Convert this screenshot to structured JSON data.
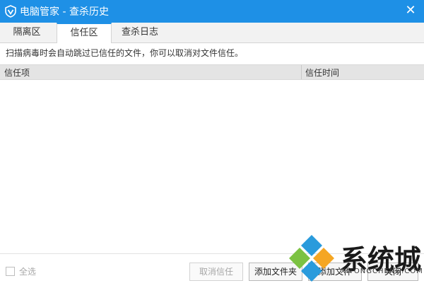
{
  "window": {
    "title": "电脑管家 - 查杀历史",
    "close_glyph": "✕"
  },
  "tabs": [
    {
      "label": "隔离区"
    },
    {
      "label": "信任区"
    },
    {
      "label": "查杀日志"
    }
  ],
  "active_tab": "信任区",
  "description": "扫描病毒时会自动跳过已信任的文件，你可以取消对文件信任。",
  "table": {
    "columns": [
      "信任项",
      "信任时间"
    ],
    "rows": []
  },
  "footer": {
    "select_all_label": "全选",
    "buttons": {
      "cancel_trust": "取消信任",
      "add_folder": "添加文件夹",
      "add_file": "添加文件",
      "close": "关闭"
    }
  },
  "watermark": {
    "text": "系统城",
    "subtext": "XITONGCHENG.COM"
  },
  "colors": {
    "titlebar": "#1e90e6",
    "accent": "#1e90e6",
    "disabled_text": "#a7a7a7"
  },
  "icons": {
    "logo": "shield-v-icon",
    "close": "close-icon",
    "watermark_logo": "diamond-logo-icon"
  }
}
